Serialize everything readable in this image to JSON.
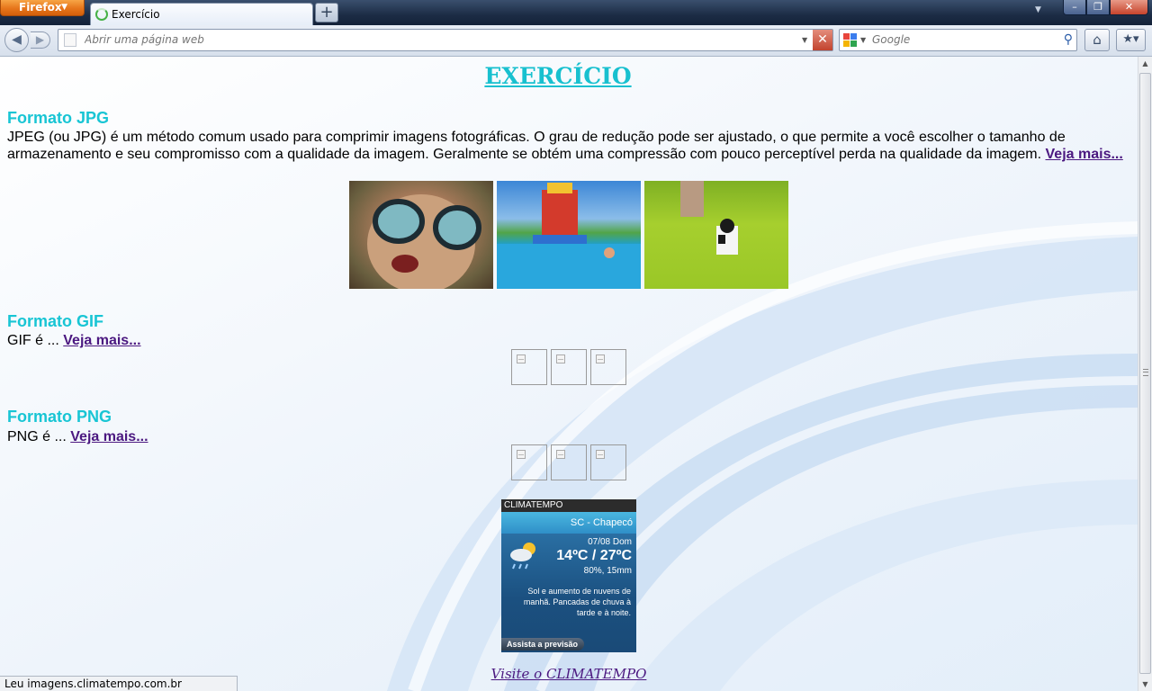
{
  "browser": {
    "menu_button": "Firefox",
    "tab_title": "Exercício",
    "new_tab": "+",
    "url_placeholder": "Abrir uma página web",
    "search_placeholder": "Google",
    "status_text": "Leu imagens.climatempo.com.br"
  },
  "page": {
    "title": "EXERCÍCIO",
    "sections": [
      {
        "heading": "Formato JPG",
        "text": "JPEG (ou JPG) é um método comum usado para comprimir imagens fotográficas. O grau de redução pode ser ajustado, o que permite a você escolher o tamanho de armazenamento e seu compromisso com a qualidade da imagem. Geralmente se obtém uma compressão com pouco perceptível perda na qualidade da imagem.",
        "link": "Veja mais..."
      },
      {
        "heading": "Formato GIF",
        "text": "GIF é ...",
        "link": "Veja mais..."
      },
      {
        "heading": "Formato PNG",
        "text": "PNG é ...",
        "link": "Veja mais..."
      }
    ],
    "widget": {
      "brand": "CLIMATEMPO",
      "location": "SC - Chapecó",
      "date": "07/08 Dom",
      "temperature": "14ºC / 27ºC",
      "rain": "80%, 15mm",
      "description": "Sol e aumento de nuvens de manhã. Pancadas de chuva à tarde e à noite.",
      "button": "Assista a previsão"
    },
    "visit_link": "Visite o CLIMATEMPO"
  }
}
